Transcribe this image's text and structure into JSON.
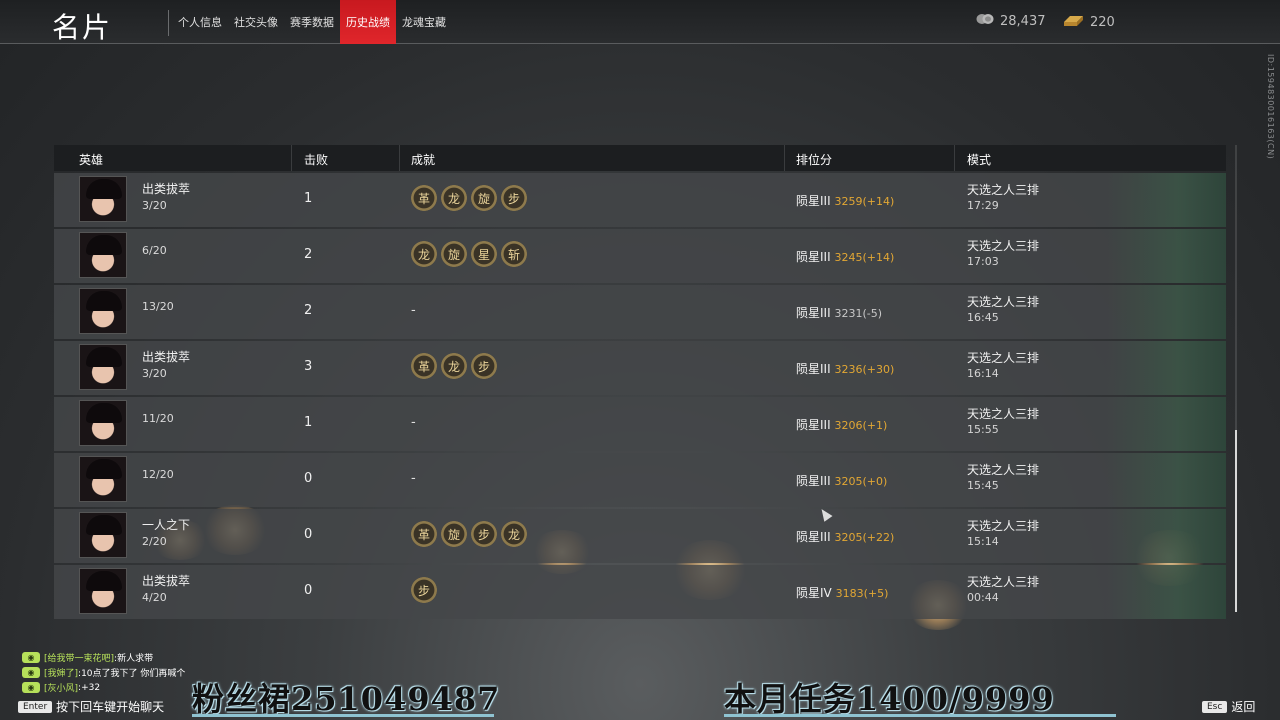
{
  "header": {
    "title": "名片",
    "tabs": [
      {
        "label": "个人信息",
        "active": false
      },
      {
        "label": "社交头像",
        "active": false
      },
      {
        "label": "赛季数据",
        "active": false
      },
      {
        "label": "历史战绩",
        "active": true
      },
      {
        "label": "龙魂宝藏",
        "active": false
      }
    ],
    "currency": [
      {
        "icon": "coins-icon",
        "value": "28,437"
      },
      {
        "icon": "gold-ingot-icon",
        "value": "220"
      }
    ],
    "side_id": "ID:1594830016163(CN)"
  },
  "table": {
    "columns": [
      "英雄",
      "击败",
      "成就",
      "排位分",
      "模式"
    ],
    "rows": [
      {
        "title": "出类拔萃",
        "placement": "3/20",
        "kills": "1",
        "achievements": [
          "革",
          "龙",
          "旋",
          "步"
        ],
        "tier": "陨星III",
        "score": "3259(+14)",
        "mode": "天选之人三排",
        "time": "17:29"
      },
      {
        "title": "",
        "placement": "6/20",
        "kills": "2",
        "achievements": [
          "龙",
          "旋",
          "星",
          "斩"
        ],
        "tier": "陨星III",
        "score": "3245(+14)",
        "mode": "天选之人三排",
        "time": "17:03"
      },
      {
        "title": "",
        "placement": "13/20",
        "kills": "2",
        "achievements": [],
        "tier": "陨星III",
        "score": "3231(-5)",
        "mode": "天选之人三排",
        "time": "16:45"
      },
      {
        "title": "出类拔萃",
        "placement": "3/20",
        "kills": "3",
        "achievements": [
          "革",
          "龙",
          "步"
        ],
        "tier": "陨星III",
        "score": "3236(+30)",
        "mode": "天选之人三排",
        "time": "16:14"
      },
      {
        "title": "",
        "placement": "11/20",
        "kills": "1",
        "achievements": [],
        "tier": "陨星III",
        "score": "3206(+1)",
        "mode": "天选之人三排",
        "time": "15:55"
      },
      {
        "title": "",
        "placement": "12/20",
        "kills": "0",
        "achievements": [],
        "tier": "陨星III",
        "score": "3205(+0)",
        "mode": "天选之人三排",
        "time": "15:45"
      },
      {
        "title": "一人之下",
        "placement": "2/20",
        "kills": "0",
        "achievements": [
          "革",
          "旋",
          "步",
          "龙"
        ],
        "tier": "陨星III",
        "score": "3205(+22)",
        "mode": "天选之人三排",
        "time": "15:14"
      },
      {
        "title": "出类拔萃",
        "placement": "4/20",
        "kills": "0",
        "achievements": [
          "步"
        ],
        "tier": "陨星IV",
        "score": "3183(+5)",
        "mode": "天选之人三排",
        "time": "00:44"
      }
    ],
    "empty_achievement": "-"
  },
  "chat": [
    {
      "name": "[给我带一束花吧]",
      "text": ":新人求带"
    },
    {
      "name": "[我婶了]",
      "text": ":10点了我下了 你们再喊个"
    },
    {
      "name": "[灰小风]",
      "text": ":+32"
    }
  ],
  "footer": {
    "enter_key": "Enter",
    "enter_hint": "按下回车键开始聊天",
    "esc_key": "Esc",
    "esc_label": "返回"
  },
  "overlay": {
    "fan_group": "粉丝裙251049487",
    "monthly_task": "本月任务1400/9999"
  }
}
